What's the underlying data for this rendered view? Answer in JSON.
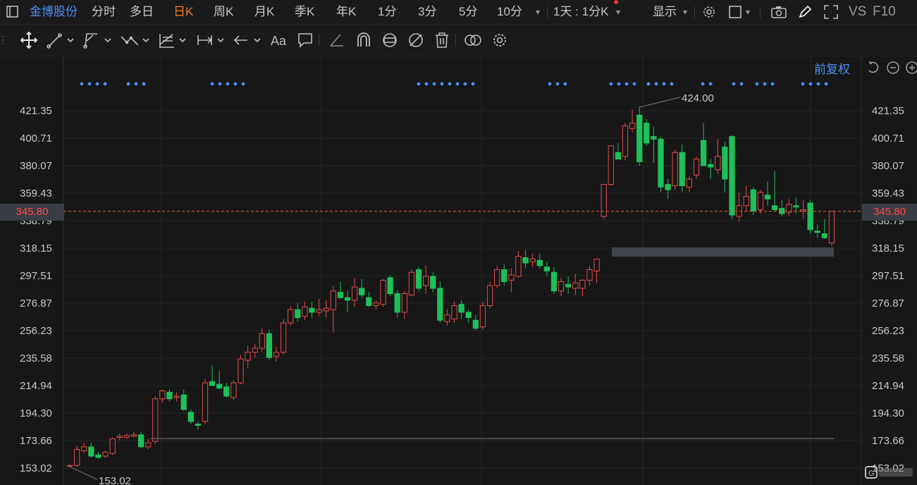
{
  "topbar": {
    "stock_name": "金博股份",
    "periods": [
      "分时",
      "多日",
      "日K",
      "周K",
      "月K",
      "季K",
      "年K",
      "1分",
      "3分",
      "5分",
      "10分"
    ],
    "active_period": "日K",
    "interval_select": "1天 : 1分K",
    "display_label": "显示",
    "vs_label": "VS",
    "f10_label": "F10"
  },
  "adjust_label": "前复权",
  "colors": {
    "up": "#e54a4a",
    "down": "#1fbf5a",
    "accent": "#4d8ff2",
    "active": "#f07a28",
    "dashed_line": "#e0623a"
  },
  "price_axis": {
    "labels": [
      "421.35",
      "400.71",
      "380.07",
      "359.43",
      "338.79",
      "318.15",
      "297.51",
      "276.87",
      "256.23",
      "235.58",
      "214.94",
      "194.30",
      "173.66",
      "153.02"
    ],
    "current_price": "345.80"
  },
  "annotations": {
    "high_label": "424.00",
    "low_label": "153.02"
  },
  "chart_data": {
    "type": "candlestick",
    "ylim": [
      153.02,
      421.35
    ],
    "current_price": 345.8,
    "ohlc": [
      [
        154.5,
        156.0,
        154.0,
        155.0
      ],
      [
        155.0,
        170.0,
        154.0,
        167.0
      ],
      [
        166.0,
        172.0,
        164.0,
        169.0
      ],
      [
        169.0,
        172.0,
        161.0,
        162.0
      ],
      [
        163.0,
        165.0,
        160.0,
        161.0
      ],
      [
        162.0,
        166.0,
        160.5,
        165.0
      ],
      [
        164.0,
        176.0,
        163.0,
        175.0
      ],
      [
        176.0,
        179.0,
        174.0,
        177.0
      ],
      [
        176.0,
        179.0,
        175.0,
        177.5
      ],
      [
        177.0,
        180.0,
        176.0,
        178.0
      ],
      [
        178.0,
        180.0,
        168.0,
        169.0
      ],
      [
        169.0,
        175.0,
        167.0,
        172.0
      ],
      [
        173.0,
        207.0,
        171.0,
        205.0
      ],
      [
        205.0,
        212.0,
        202.0,
        211.0
      ],
      [
        210.0,
        212.0,
        203.0,
        205.0
      ],
      [
        206.0,
        210.0,
        203.0,
        207.0
      ],
      [
        208.0,
        212.0,
        196.0,
        197.0
      ],
      [
        195.0,
        197.0,
        186.0,
        188.0
      ],
      [
        186.0,
        188.0,
        182.0,
        185.0
      ],
      [
        188.0,
        220.0,
        186.0,
        217.0
      ],
      [
        218.0,
        230.0,
        215.0,
        215.0
      ],
      [
        216.0,
        226.0,
        212.0,
        213.0
      ],
      [
        214.0,
        217.0,
        206.0,
        207.0
      ],
      [
        206.0,
        219.0,
        204.0,
        217.0
      ],
      [
        217.0,
        238.0,
        216.0,
        235.0
      ],
      [
        234.0,
        245.0,
        228.0,
        240.0
      ],
      [
        240.0,
        246.0,
        236.0,
        243.0
      ],
      [
        243.0,
        258.0,
        240.0,
        254.0
      ],
      [
        254.0,
        257.0,
        234.0,
        236.0
      ],
      [
        237.0,
        244.0,
        233.0,
        240.0
      ],
      [
        240.0,
        265.0,
        238.0,
        262.0
      ],
      [
        262.0,
        275.0,
        260.0,
        272.0
      ],
      [
        272.0,
        277.0,
        263.0,
        266.0
      ],
      [
        267.0,
        278.0,
        264.0,
        274.0
      ],
      [
        273.0,
        278.0,
        266.0,
        270.0
      ],
      [
        270.0,
        280.0,
        267.0,
        272.0
      ],
      [
        271.0,
        279.0,
        266.0,
        273.0
      ],
      [
        272.0,
        290.0,
        255.0,
        286.0
      ],
      [
        285.0,
        293.0,
        280.0,
        281.0
      ],
      [
        281.0,
        286.0,
        270.0,
        279.0
      ],
      [
        279.0,
        296.0,
        274.0,
        289.0
      ],
      [
        288.0,
        295.0,
        281.0,
        283.0
      ],
      [
        281.0,
        285.0,
        274.0,
        275.0
      ],
      [
        275.0,
        279.0,
        272.0,
        277.0
      ],
      [
        276.0,
        295.0,
        274.0,
        294.0
      ],
      [
        296.0,
        298.0,
        282.0,
        284.0
      ],
      [
        284.0,
        287.0,
        266.0,
        270.0
      ],
      [
        270.0,
        286.0,
        265.0,
        284.0
      ],
      [
        283.0,
        302.0,
        282.0,
        300.0
      ],
      [
        302.0,
        304.0,
        286.0,
        288.0
      ],
      [
        290.0,
        305.0,
        284.0,
        297.0
      ],
      [
        297.0,
        300.0,
        285.0,
        288.0
      ],
      [
        288.0,
        293.0,
        262.0,
        264.0
      ],
      [
        263.0,
        272.0,
        260.0,
        268.0
      ],
      [
        265.0,
        278.0,
        262.0,
        275.0
      ],
      [
        276.0,
        279.0,
        265.0,
        270.0
      ],
      [
        270.0,
        272.0,
        262.0,
        266.0
      ],
      [
        264.0,
        268.0,
        256.0,
        258.0
      ],
      [
        259.0,
        278.0,
        257.0,
        275.0
      ],
      [
        275.0,
        293.0,
        273.0,
        290.0
      ],
      [
        290.0,
        305.0,
        288.0,
        302.0
      ],
      [
        302.0,
        306.0,
        290.0,
        293.0
      ],
      [
        294.0,
        303.0,
        285.0,
        298.0
      ],
      [
        297.0,
        316.0,
        296.0,
        312.0
      ],
      [
        311.0,
        317.0,
        303.0,
        307.0
      ],
      [
        308.0,
        314.0,
        304.0,
        310.0
      ],
      [
        309.0,
        314.0,
        303.0,
        305.0
      ],
      [
        304.0,
        308.0,
        297.0,
        301.0
      ],
      [
        300.0,
        304.0,
        284.0,
        286.0
      ],
      [
        286.0,
        296.0,
        282.0,
        293.0
      ],
      [
        291.0,
        297.0,
        284.0,
        289.0
      ],
      [
        288.0,
        299.0,
        283.0,
        292.0
      ],
      [
        288.0,
        295.0,
        282.0,
        294.0
      ],
      [
        294.0,
        305.0,
        290.0,
        302.0
      ],
      [
        301.0,
        310.0,
        292.0,
        310.0
      ],
      [
        342.0,
        366.0,
        340.0,
        366.0
      ],
      [
        366.0,
        395.0,
        365.0,
        395.0
      ],
      [
        390.0,
        397.0,
        388.0,
        385.0
      ],
      [
        387.0,
        412.0,
        384.0,
        410.0
      ],
      [
        408.0,
        422.0,
        405.0,
        412.0
      ],
      [
        418.0,
        424.0,
        380.0,
        383.0
      ],
      [
        412.0,
        415.0,
        395.0,
        397.0
      ],
      [
        402.0,
        409.0,
        382.0,
        400.0
      ],
      [
        400.0,
        402.0,
        360.0,
        364.0
      ],
      [
        366.0,
        370.0,
        355.0,
        362.0
      ],
      [
        365.0,
        392.0,
        362.0,
        390.0
      ],
      [
        390.0,
        396.0,
        360.0,
        365.0
      ],
      [
        364.0,
        372.0,
        360.0,
        370.0
      ],
      [
        373.0,
        387.0,
        370.0,
        385.0
      ],
      [
        399.0,
        412.0,
        388.0,
        380.0
      ],
      [
        381.0,
        385.0,
        370.0,
        379.0
      ],
      [
        377.0,
        400.0,
        374.0,
        387.0
      ],
      [
        394.0,
        398.0,
        360.0,
        370.0
      ],
      [
        402.0,
        403.0,
        340.0,
        343.0
      ],
      [
        342.0,
        360.0,
        338.0,
        350.0
      ],
      [
        350.0,
        365.0,
        346.0,
        357.0
      ],
      [
        362.0,
        364.0,
        343.0,
        346.0
      ],
      [
        347.0,
        362.0,
        344.0,
        360.0
      ],
      [
        358.0,
        368.0,
        350.0,
        355.0
      ],
      [
        350.0,
        376.0,
        346.0,
        347.0
      ],
      [
        348.0,
        354.0,
        342.0,
        344.0
      ],
      [
        345.0,
        355.0,
        342.0,
        351.0
      ],
      [
        350.0,
        356.0,
        344.0,
        349.0
      ],
      [
        346.0,
        354.0,
        340.0,
        347.0
      ],
      [
        352.0,
        354.0,
        329.0,
        332.0
      ],
      [
        331.0,
        336.0,
        326.0,
        330.0
      ],
      [
        329.0,
        340.0,
        325.0,
        326.0
      ],
      [
        322.0,
        346.0,
        320.0,
        345.8
      ]
    ]
  }
}
